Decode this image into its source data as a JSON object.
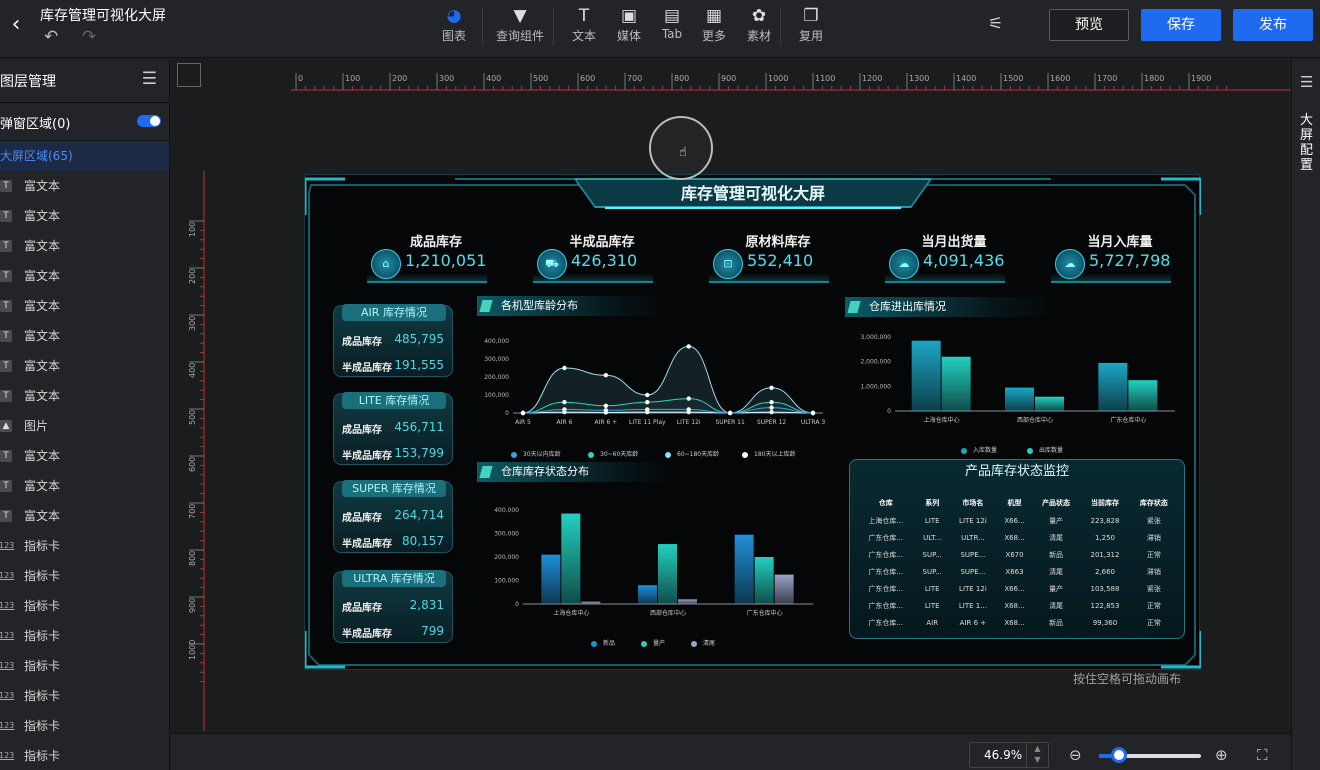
{
  "app": {
    "title": "库存管理可视化大屏"
  },
  "toolbar": [
    {
      "label": "图表",
      "icon": "pie-chart-icon",
      "glyph": "◕",
      "active": true
    },
    {
      "label": "查询组件",
      "icon": "filter-icon",
      "glyph": "▼"
    },
    {
      "label": "文本",
      "icon": "text-icon",
      "glyph": "T"
    },
    {
      "label": "媒体",
      "icon": "image-icon",
      "glyph": "▣"
    },
    {
      "label": "Tab",
      "icon": "tab-icon",
      "glyph": "▤"
    },
    {
      "label": "更多",
      "icon": "grid-icon",
      "glyph": "▦"
    },
    {
      "label": "素材",
      "icon": "palette-icon",
      "glyph": "✿"
    },
    {
      "label": "复用",
      "icon": "copy-icon",
      "glyph": "❐"
    }
  ],
  "actions": {
    "preview": "预览",
    "save": "保存",
    "publish": "发布"
  },
  "layers": {
    "title": "图层管理",
    "popup_label": "弹窗区域(0)",
    "group_label": "大屏区域(65)",
    "items": [
      {
        "label": "富文本",
        "type": "text"
      },
      {
        "label": "富文本",
        "type": "text"
      },
      {
        "label": "富文本",
        "type": "text"
      },
      {
        "label": "富文本",
        "type": "text"
      },
      {
        "label": "富文本",
        "type": "text"
      },
      {
        "label": "富文本",
        "type": "text"
      },
      {
        "label": "富文本",
        "type": "text"
      },
      {
        "label": "富文本",
        "type": "text"
      },
      {
        "label": "图片",
        "type": "image"
      },
      {
        "label": "富文本",
        "type": "text"
      },
      {
        "label": "富文本",
        "type": "text"
      },
      {
        "label": "富文本",
        "type": "text"
      },
      {
        "label": "指标卡",
        "type": "num"
      },
      {
        "label": "指标卡",
        "type": "num"
      },
      {
        "label": "指标卡",
        "type": "num"
      },
      {
        "label": "指标卡",
        "type": "num"
      },
      {
        "label": "指标卡",
        "type": "num"
      },
      {
        "label": "指标卡",
        "type": "num"
      },
      {
        "label": "指标卡",
        "type": "num"
      },
      {
        "label": "指标卡",
        "type": "num"
      }
    ]
  },
  "ruler": {
    "h_ticks": [
      "0",
      "100",
      "200",
      "300",
      "400",
      "500",
      "600",
      "700",
      "800",
      "900",
      "1000",
      "1100",
      "1200",
      "1300",
      "1400",
      "1500",
      "1600",
      "1700",
      "1800",
      "1900"
    ],
    "v_ticks": [
      "100",
      "200",
      "300",
      "400",
      "500",
      "600",
      "700",
      "800",
      "900",
      "1000"
    ]
  },
  "right_panel": {
    "label": "大屏配置"
  },
  "canvas_hint": "按住空格可拖动画布",
  "zoom": {
    "value": "46.9%",
    "level": 0.2
  },
  "dashboard": {
    "title": "库存管理可视化大屏",
    "kpis": [
      {
        "label": "成品库存",
        "value": "1,210,051"
      },
      {
        "label": "半成品库存",
        "value": "426,310"
      },
      {
        "label": "原材料库存",
        "value": "552,410"
      },
      {
        "label": "当月出货量",
        "value": "4,091,436"
      },
      {
        "label": "当月入库量",
        "value": "5,727,798"
      }
    ],
    "series_cards": [
      {
        "title": "AIR 库存情况",
        "rows": [
          {
            "label": "成品库存",
            "value": "485,795"
          },
          {
            "label": "半成品库存",
            "value": "191,555"
          }
        ]
      },
      {
        "title": "LITE 库存情况",
        "rows": [
          {
            "label": "成品库存",
            "value": "456,711"
          },
          {
            "label": "半成品库存",
            "value": "153,799"
          }
        ]
      },
      {
        "title": "SUPER 库存情况",
        "rows": [
          {
            "label": "成品库存",
            "value": "264,714"
          },
          {
            "label": "半成品库存",
            "value": "80,157"
          }
        ]
      },
      {
        "title": "ULTRA 库存情况",
        "rows": [
          {
            "label": "成品库存",
            "value": "2,831"
          },
          {
            "label": "半成品库存",
            "value": "799"
          }
        ]
      }
    ],
    "panels": {
      "age": "各机型库龄分布",
      "inout": "仓库进出库情况",
      "status": "仓库库存状态分布"
    },
    "table": {
      "title": "产品库存状态监控",
      "headers": [
        "仓库",
        "系列",
        "市场名",
        "机型",
        "产品状态",
        "当前库存",
        "库存状态"
      ],
      "rows": [
        [
          "上海仓库...",
          "LITE",
          "LITE 12i",
          "X66...",
          "量产",
          "223,828",
          "紧张"
        ],
        [
          "广东仓库...",
          "ULT...",
          "ULTR...",
          "X68...",
          "清尾",
          "1,250",
          "滞销"
        ],
        [
          "广东仓库...",
          "SUP...",
          "SUPE...",
          "X670",
          "新品",
          "201,312",
          "正常"
        ],
        [
          "广东仓库...",
          "SUP...",
          "SUPE...",
          "X663",
          "清尾",
          "2,660",
          "滞销"
        ],
        [
          "广东仓库...",
          "LITE",
          "LITE 12i",
          "X66...",
          "量产",
          "103,588",
          "紧张"
        ],
        [
          "广东仓库...",
          "LITE",
          "LITE 1...",
          "X68...",
          "清尾",
          "122,853",
          "正常"
        ],
        [
          "广东仓库...",
          "AIR",
          "AIR 6 +",
          "X68...",
          "新品",
          "99,360",
          "正常"
        ]
      ]
    }
  },
  "chart_data": [
    {
      "type": "line",
      "title": "各机型库龄分布",
      "categories": [
        "AIR 5",
        "AIR 6",
        "AIR 6 +",
        "LITE 11 Play",
        "LITE 12i",
        "SUPER 11",
        "SUPER 12",
        "ULTRA 3"
      ],
      "ylim": [
        0,
        400000
      ],
      "yticks": [
        "0",
        "100,000",
        "200,000",
        "300,000",
        "400,000"
      ],
      "series": [
        {
          "name": "30天以内库龄",
          "color": "#3aa0e0",
          "values": [
            0,
            20000,
            15000,
            20000,
            20000,
            0,
            30000,
            0
          ]
        },
        {
          "name": "30~60天库龄",
          "color": "#2fd3c4",
          "values": [
            0,
            60000,
            40000,
            60000,
            80000,
            0,
            60000,
            0
          ]
        },
        {
          "name": "60~180天库龄",
          "color": "#7ee8f2",
          "values": [
            0,
            250000,
            210000,
            100000,
            370000,
            0,
            140000,
            0
          ]
        },
        {
          "name": "180天以上库龄",
          "color": "#ffffff",
          "values": [
            0,
            5000,
            3000,
            5000,
            5000,
            0,
            5000,
            0
          ]
        }
      ]
    },
    {
      "type": "bar",
      "title": "仓库进出库情况",
      "categories": [
        "上海仓库中心",
        "西部仓库中心",
        "广东仓库中心"
      ],
      "ylim": [
        0,
        3000000
      ],
      "yticks": [
        "0",
        "1,000,000",
        "2,000,000",
        "3,000,000"
      ],
      "series": [
        {
          "name": "入库数量",
          "color": "#1ba7c5",
          "values": [
            2850000,
            950000,
            1950000
          ]
        },
        {
          "name": "出库数量",
          "color": "#22d1c0",
          "values": [
            2200000,
            580000,
            1250000
          ]
        }
      ]
    },
    {
      "type": "bar",
      "title": "仓库库存状态分布",
      "categories": [
        "上海仓库中心",
        "西部仓库中心",
        "广东仓库中心"
      ],
      "ylim": [
        0,
        400000
      ],
      "yticks": [
        "0",
        "100,000",
        "200,000",
        "300,000",
        "400,000"
      ],
      "series": [
        {
          "name": "新品",
          "color": "#1f8fd8",
          "values": [
            210000,
            80000,
            295000
          ]
        },
        {
          "name": "量产",
          "color": "#22d1c0",
          "values": [
            385000,
            255000,
            200000
          ]
        },
        {
          "name": "清尾",
          "color": "#9aa3c8",
          "values": [
            10000,
            20000,
            125000
          ]
        }
      ]
    }
  ]
}
